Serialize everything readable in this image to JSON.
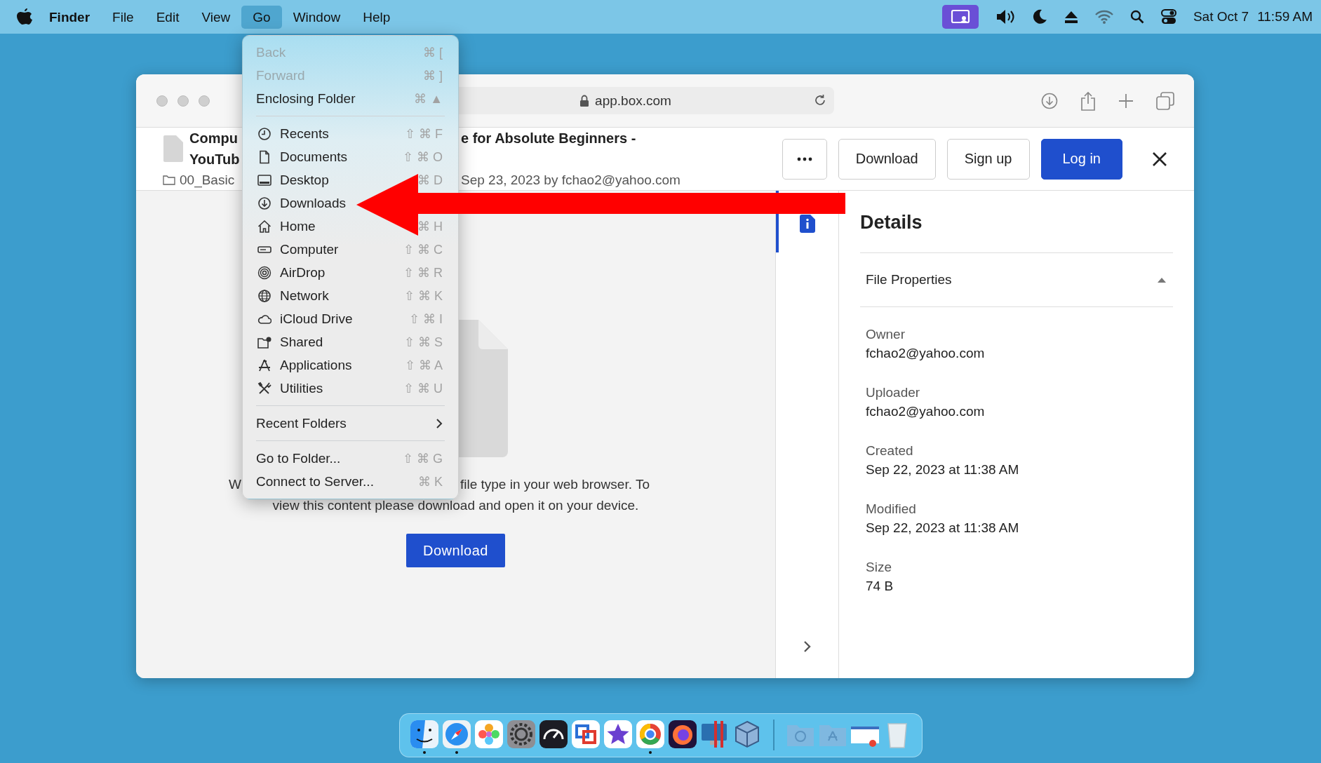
{
  "menu_bar": {
    "app": "Finder",
    "menus": [
      {
        "label": "File",
        "selected": false
      },
      {
        "label": "Edit",
        "selected": false
      },
      {
        "label": "View",
        "selected": false
      },
      {
        "label": "Go",
        "selected": true
      },
      {
        "label": "Window",
        "selected": false
      },
      {
        "label": "Help",
        "selected": false
      }
    ],
    "date": "Sat Oct 7",
    "time": "11:59 AM"
  },
  "go_menu": {
    "items": [
      {
        "kind": "item",
        "label": "Back",
        "shortcut": "⌘ [",
        "disabled": true
      },
      {
        "kind": "item",
        "label": "Forward",
        "shortcut": "⌘ ]",
        "disabled": true
      },
      {
        "kind": "item",
        "label": "Enclosing Folder",
        "shortcut": "⌘ ▲",
        "disabled": false
      },
      {
        "kind": "separator"
      },
      {
        "kind": "place",
        "label": "Recents",
        "shortcut": "⇧ ⌘ F",
        "disabled": false
      },
      {
        "kind": "place",
        "label": "Documents",
        "shortcut": "⇧ ⌘ O",
        "disabled": false
      },
      {
        "kind": "place",
        "label": "Desktop",
        "shortcut": "⌘ D",
        "disabled": false
      },
      {
        "kind": "place",
        "label": "Downloads",
        "disabled": false
      },
      {
        "kind": "place",
        "label": "Home",
        "shortcut": "⌘ H",
        "disabled": false
      },
      {
        "kind": "place",
        "label": "Computer",
        "shortcut": "⇧ ⌘ C",
        "disabled": false
      },
      {
        "kind": "place",
        "label": "AirDrop",
        "shortcut": "⇧ ⌘ R",
        "disabled": false
      },
      {
        "kind": "place",
        "label": "Network",
        "shortcut": "⇧ ⌘ K",
        "disabled": false
      },
      {
        "kind": "place",
        "label": "iCloud Drive",
        "shortcut": "⇧ ⌘ I",
        "disabled": false
      },
      {
        "kind": "place",
        "label": "Shared",
        "shortcut": "⇧ ⌘ S",
        "disabled": false
      },
      {
        "kind": "place",
        "label": "Applications",
        "shortcut": "⇧ ⌘ A",
        "disabled": false
      },
      {
        "kind": "place",
        "label": "Utilities",
        "shortcut": "⇧ ⌘ U",
        "disabled": false
      },
      {
        "kind": "separator"
      },
      {
        "kind": "submenu",
        "label": "Recent Folders",
        "disabled": false
      },
      {
        "kind": "separator"
      },
      {
        "kind": "item",
        "label": "Go to Folder...",
        "shortcut": "⇧ ⌘ G",
        "disabled": false
      },
      {
        "kind": "item",
        "label": "Connect to Server...",
        "shortcut": "⌘ K",
        "disabled": false
      }
    ]
  },
  "browser": {
    "address": "app.box.com"
  },
  "file_header": {
    "name_lines": [
      "Compu",
      "YouTub"
    ],
    "folder": "00_Basic",
    "title_rest": "e for Absolute Beginners -",
    "meta": "Sep 23, 2023 by fchao2@yahoo.com",
    "buttons": [
      {
        "label": "Download",
        "kind": "outline"
      },
      {
        "label": "Sign up",
        "kind": "outline"
      },
      {
        "label": "Log in",
        "kind": "primary"
      }
    ]
  },
  "preview": {
    "message_start": "W",
    "message_rest": "file type in your web browser. To",
    "message_line2": "view this content please download and open it on your device.",
    "button": "Download"
  },
  "details": {
    "title": "Details",
    "section": {
      "title": "File Properties",
      "expanded": true
    },
    "properties": [
      {
        "label": "Owner",
        "value": "fchao2@yahoo.com"
      },
      {
        "label": "Uploader",
        "value": "fchao2@yahoo.com"
      },
      {
        "label": "Created",
        "value": "Sep 22, 2023 at 11:38 AM"
      },
      {
        "label": "Modified",
        "value": "Sep 22, 2023 at 11:38 AM"
      },
      {
        "label": "Size",
        "value": "74 B"
      }
    ]
  },
  "dock": {
    "apps": [
      {
        "running": true
      },
      {
        "running": true
      },
      {
        "running": false
      },
      {
        "running": false
      },
      {
        "running": false
      },
      {
        "running": false
      },
      {
        "running": false
      },
      {
        "running": true
      },
      {
        "running": false
      },
      {
        "running": false
      },
      {
        "running": false
      }
    ]
  }
}
